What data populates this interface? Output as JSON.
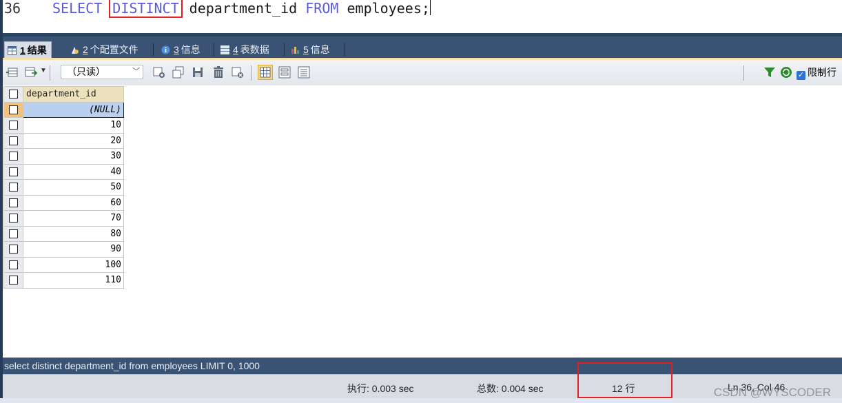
{
  "editor": {
    "line_number": "36",
    "kw_select": "SELECT",
    "kw_distinct": "DISTINCT",
    "column": "department_id",
    "kw_from": "FROM",
    "table": "employees;"
  },
  "tabs": [
    {
      "num": "1",
      "label": "结果"
    },
    {
      "num": "2",
      "label": "个配置文件"
    },
    {
      "num": "3",
      "label": "信息"
    },
    {
      "num": "4",
      "label": "表数据"
    },
    {
      "num": "5",
      "label": "信息"
    }
  ],
  "toolbar": {
    "mode_select": "（只读）",
    "limit_label": "限制行"
  },
  "grid": {
    "header": "department_id",
    "rows": [
      "(NULL)",
      "10",
      "20",
      "30",
      "40",
      "50",
      "60",
      "70",
      "80",
      "90",
      "100",
      "110"
    ]
  },
  "status": {
    "query": "select distinct department_id from employees LIMIT 0, 1000",
    "exec_time": "执行: 0.003 sec",
    "total_time": "总数: 0.004 sec",
    "row_count": "12 行",
    "cursor_pos": "Ln 36, Col 46",
    "watermark": "CSDN @WYSCODER"
  },
  "colors": {
    "keyword": "#5a5ad8",
    "highlight_box": "#e02020",
    "tab_bar": "#3a5374"
  }
}
